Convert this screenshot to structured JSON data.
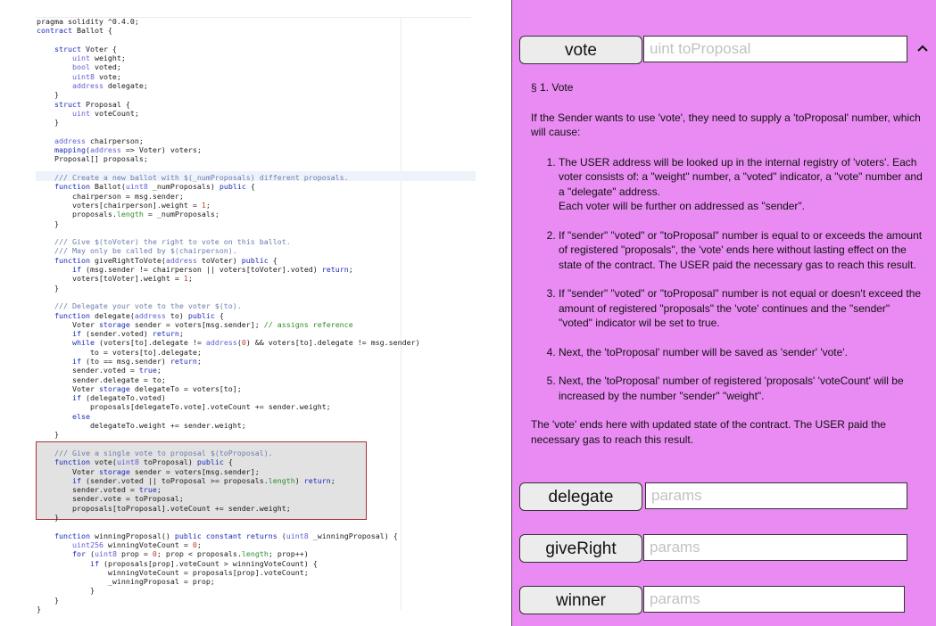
{
  "editor": {
    "code_lines": [
      [
        [
          "pragma solidity ^0.4.0;",
          "nm"
        ]
      ],
      [
        [
          "contract",
          "kw"
        ],
        [
          " Ballot {",
          "nm"
        ]
      ],
      [],
      [
        [
          "    ",
          "nm"
        ],
        [
          "struct",
          "kw"
        ],
        [
          " Voter {",
          "nm"
        ]
      ],
      [
        [
          "        ",
          "nm"
        ],
        [
          "uint",
          "ty"
        ],
        [
          " weight;",
          "nm"
        ]
      ],
      [
        [
          "        ",
          "nm"
        ],
        [
          "bool",
          "ty"
        ],
        [
          " voted;",
          "nm"
        ]
      ],
      [
        [
          "        ",
          "nm"
        ],
        [
          "uint8",
          "ty"
        ],
        [
          " vote;",
          "nm"
        ]
      ],
      [
        [
          "        ",
          "nm"
        ],
        [
          "address",
          "ty"
        ],
        [
          " delegate;",
          "nm"
        ]
      ],
      [
        [
          "    }",
          "nm"
        ]
      ],
      [
        [
          "    ",
          "nm"
        ],
        [
          "struct",
          "kw"
        ],
        [
          " Proposal {",
          "nm"
        ]
      ],
      [
        [
          "        ",
          "nm"
        ],
        [
          "uint",
          "ty"
        ],
        [
          " voteCount;",
          "nm"
        ]
      ],
      [
        [
          "    }",
          "nm"
        ]
      ],
      [],
      [
        [
          "    ",
          "nm"
        ],
        [
          "address",
          "ty"
        ],
        [
          " chairperson;",
          "nm"
        ]
      ],
      [
        [
          "    ",
          "nm"
        ],
        [
          "mapping",
          "kw"
        ],
        [
          "(",
          "nm"
        ],
        [
          "address",
          "ty"
        ],
        [
          " => Voter) voters;",
          "nm"
        ]
      ],
      [
        [
          "    Proposal[] proposals;",
          "nm"
        ]
      ],
      [],
      [
        [
          "    ",
          "nm"
        ],
        [
          "/// Create a new ballot with $(_numProposals) different proposals.",
          "cm"
        ]
      ],
      [
        [
          "    ",
          "nm"
        ],
        [
          "function",
          "kw"
        ],
        [
          " Ballot(",
          "nm"
        ],
        [
          "uint8",
          "ty"
        ],
        [
          " _numProposals) ",
          "nm"
        ],
        [
          "public",
          "kw"
        ],
        [
          " {",
          "nm"
        ]
      ],
      [
        [
          "        chairperson = msg.sender;",
          "nm"
        ]
      ],
      [
        [
          "        voters[chairperson].weight = ",
          "nm"
        ],
        [
          "1",
          "or"
        ],
        [
          ";",
          "nm"
        ]
      ],
      [
        [
          "        proposals.",
          "nm"
        ],
        [
          "length",
          "gr"
        ],
        [
          " = _numProposals;",
          "nm"
        ]
      ],
      [
        [
          "    }",
          "nm"
        ]
      ],
      [],
      [
        [
          "    ",
          "nm"
        ],
        [
          "/// Give $(toVoter) the right to vote on this ballot.",
          "cm"
        ]
      ],
      [
        [
          "    ",
          "nm"
        ],
        [
          "/// May only be called by $(chairperson).",
          "cm"
        ]
      ],
      [
        [
          "    ",
          "nm"
        ],
        [
          "function",
          "kw"
        ],
        [
          " giveRightToVote(",
          "nm"
        ],
        [
          "address",
          "ty"
        ],
        [
          " toVoter) ",
          "nm"
        ],
        [
          "public",
          "kw"
        ],
        [
          " {",
          "nm"
        ]
      ],
      [
        [
          "        ",
          "nm"
        ],
        [
          "if",
          "kw"
        ],
        [
          " (msg.sender != chairperson || voters[toVoter].voted) ",
          "nm"
        ],
        [
          "return",
          "kw"
        ],
        [
          ";",
          "nm"
        ]
      ],
      [
        [
          "        voters[toVoter].weight = ",
          "nm"
        ],
        [
          "1",
          "or"
        ],
        [
          ";",
          "nm"
        ]
      ],
      [
        [
          "    }",
          "nm"
        ]
      ],
      [],
      [
        [
          "    ",
          "nm"
        ],
        [
          "/// Delegate your vote to the voter $(to).",
          "cm"
        ]
      ],
      [
        [
          "    ",
          "nm"
        ],
        [
          "function",
          "kw"
        ],
        [
          " delegate(",
          "nm"
        ],
        [
          "address",
          "ty"
        ],
        [
          " to) ",
          "nm"
        ],
        [
          "public",
          "kw"
        ],
        [
          " {",
          "nm"
        ]
      ],
      [
        [
          "        Voter ",
          "nm"
        ],
        [
          "storage",
          "kw"
        ],
        [
          " sender = voters[msg.sender]; ",
          "nm"
        ],
        [
          "// assigns reference",
          "gr"
        ]
      ],
      [
        [
          "        ",
          "nm"
        ],
        [
          "if",
          "kw"
        ],
        [
          " (sender.voted) ",
          "nm"
        ],
        [
          "return",
          "kw"
        ],
        [
          ";",
          "nm"
        ]
      ],
      [
        [
          "        ",
          "nm"
        ],
        [
          "while",
          "kw"
        ],
        [
          " (voters[to].delegate != ",
          "nm"
        ],
        [
          "address",
          "ty"
        ],
        [
          "(",
          "nm"
        ],
        [
          "0",
          "or"
        ],
        [
          ") && voters[to].delegate != msg.sender)",
          "nm"
        ]
      ],
      [
        [
          "            to = voters[to].delegate;",
          "nm"
        ]
      ],
      [
        [
          "        ",
          "nm"
        ],
        [
          "if",
          "kw"
        ],
        [
          " (to == msg.sender) ",
          "nm"
        ],
        [
          "return",
          "kw"
        ],
        [
          ";",
          "nm"
        ]
      ],
      [
        [
          "        sender.voted = ",
          "nm"
        ],
        [
          "true",
          "kw"
        ],
        [
          ";",
          "nm"
        ]
      ],
      [
        [
          "        sender.delegate = to;",
          "nm"
        ]
      ],
      [
        [
          "        Voter ",
          "nm"
        ],
        [
          "storage",
          "kw"
        ],
        [
          " delegateTo = voters[to];",
          "nm"
        ]
      ],
      [
        [
          "        ",
          "nm"
        ],
        [
          "if",
          "kw"
        ],
        [
          " (delegateTo.voted)",
          "nm"
        ]
      ],
      [
        [
          "            proposals[delegateTo.vote].voteCount += sender.weight;",
          "nm"
        ]
      ],
      [
        [
          "        ",
          "nm"
        ],
        [
          "else",
          "kw"
        ]
      ],
      [
        [
          "            delegateTo.weight += sender.weight;",
          "nm"
        ]
      ],
      [
        [
          "    }",
          "nm"
        ]
      ],
      [],
      [
        [
          "    ",
          "nm"
        ],
        [
          "/// Give a single vote to proposal $(toProposal).",
          "cm"
        ]
      ],
      [
        [
          "    ",
          "nm"
        ],
        [
          "function",
          "kw"
        ],
        [
          " vote(",
          "nm"
        ],
        [
          "uint8",
          "ty"
        ],
        [
          " toProposal) ",
          "nm"
        ],
        [
          "public",
          "kw"
        ],
        [
          " {",
          "nm"
        ]
      ],
      [
        [
          "        Voter ",
          "nm"
        ],
        [
          "storage",
          "kw"
        ],
        [
          " sender = voters[msg.sender];",
          "nm"
        ]
      ],
      [
        [
          "        ",
          "nm"
        ],
        [
          "if",
          "kw"
        ],
        [
          " (sender.voted || toProposal >= proposals.",
          "nm"
        ],
        [
          "length",
          "gr"
        ],
        [
          ") ",
          "nm"
        ],
        [
          "return",
          "kw"
        ],
        [
          ";",
          "nm"
        ]
      ],
      [
        [
          "        sender.voted = ",
          "nm"
        ],
        [
          "true",
          "kw"
        ],
        [
          ";",
          "nm"
        ]
      ],
      [
        [
          "        sender.vote = toProposal;",
          "nm"
        ]
      ],
      [
        [
          "        proposals[toProposal].voteCount += sender.weight;",
          "nm"
        ]
      ],
      [
        [
          "    }",
          "nm"
        ]
      ],
      [],
      [
        [
          "    ",
          "nm"
        ],
        [
          "function",
          "kw"
        ],
        [
          " winningProposal() ",
          "nm"
        ],
        [
          "public",
          "kw"
        ],
        [
          " ",
          "nm"
        ],
        [
          "constant",
          "kw"
        ],
        [
          " ",
          "nm"
        ],
        [
          "returns",
          "kw"
        ],
        [
          " (",
          "nm"
        ],
        [
          "uint8",
          "ty"
        ],
        [
          " _winningProposal) {",
          "nm"
        ]
      ],
      [
        [
          "        ",
          "nm"
        ],
        [
          "uint256",
          "ty"
        ],
        [
          " winningVoteCount = ",
          "nm"
        ],
        [
          "0",
          "or"
        ],
        [
          ";",
          "nm"
        ]
      ],
      [
        [
          "        ",
          "nm"
        ],
        [
          "for",
          "kw"
        ],
        [
          " (",
          "nm"
        ],
        [
          "uint8",
          "ty"
        ],
        [
          " prop = ",
          "nm"
        ],
        [
          "0",
          "or"
        ],
        [
          "; prop < proposals.",
          "nm"
        ],
        [
          "length",
          "gr"
        ],
        [
          "; prop++)",
          "nm"
        ]
      ],
      [
        [
          "            ",
          "nm"
        ],
        [
          "if",
          "kw"
        ],
        [
          " (proposals[prop].voteCount > winningVoteCount) {",
          "nm"
        ]
      ],
      [
        [
          "                winningVoteCount = proposals[prop].voteCount;",
          "nm"
        ]
      ],
      [
        [
          "                _winningProposal = prop;",
          "nm"
        ]
      ],
      [
        [
          "            }",
          "nm"
        ]
      ],
      [
        [
          "    }",
          "nm"
        ]
      ],
      [
        [
          "}",
          "nm"
        ]
      ]
    ]
  },
  "panel": {
    "vote": {
      "label": "vote",
      "placeholder": "uint toProposal"
    },
    "delegate": {
      "label": "delegate",
      "placeholder": "params"
    },
    "giveRight": {
      "label": "giveRight",
      "placeholder": "params"
    },
    "winner": {
      "label": "winner",
      "placeholder": "params"
    },
    "doc": {
      "heading": "§ 1. Vote",
      "intro": "If the Sender wants to use 'vote', they need to supply a 'toProposal' number, which will cause:",
      "items": [
        "The USER address will be looked up in the internal registry of 'voters'. Each voter consists of: a \"weight\" number, a \"voted\" indicator, a \"vote\" number and a \"delegate\" address.",
        "If \"sender\" \"voted\" or \"toProposal\" number is equal to or exceeds the amount of registered \"proposals\", the 'vote' ends here without lasting effect on the state of the contract. The USER paid the necessary gas to reach this result.",
        "If \"sender\" \"voted\" or \"toProposal\" number is not equal or doesn't exceed the amount of registered \"proposals\" the 'vote' continues and  the \"sender\" \"voted\" indicator wil be set to true.",
        "Next, the 'toProposal' number will be saved as 'sender' 'vote'.",
        "Next, the 'toProposal' number of registered 'proposals' 'voteCount' will be increased by the number \"sender\" \"weight\"."
      ],
      "item1_extra": "Each voter will be further on addressed as \"sender\".",
      "summary": "The 'vote' ends here with updated state of the contract. The USER paid the necessary gas to reach this result."
    },
    "icons": {
      "collapse": "chevron-up-icon"
    }
  }
}
